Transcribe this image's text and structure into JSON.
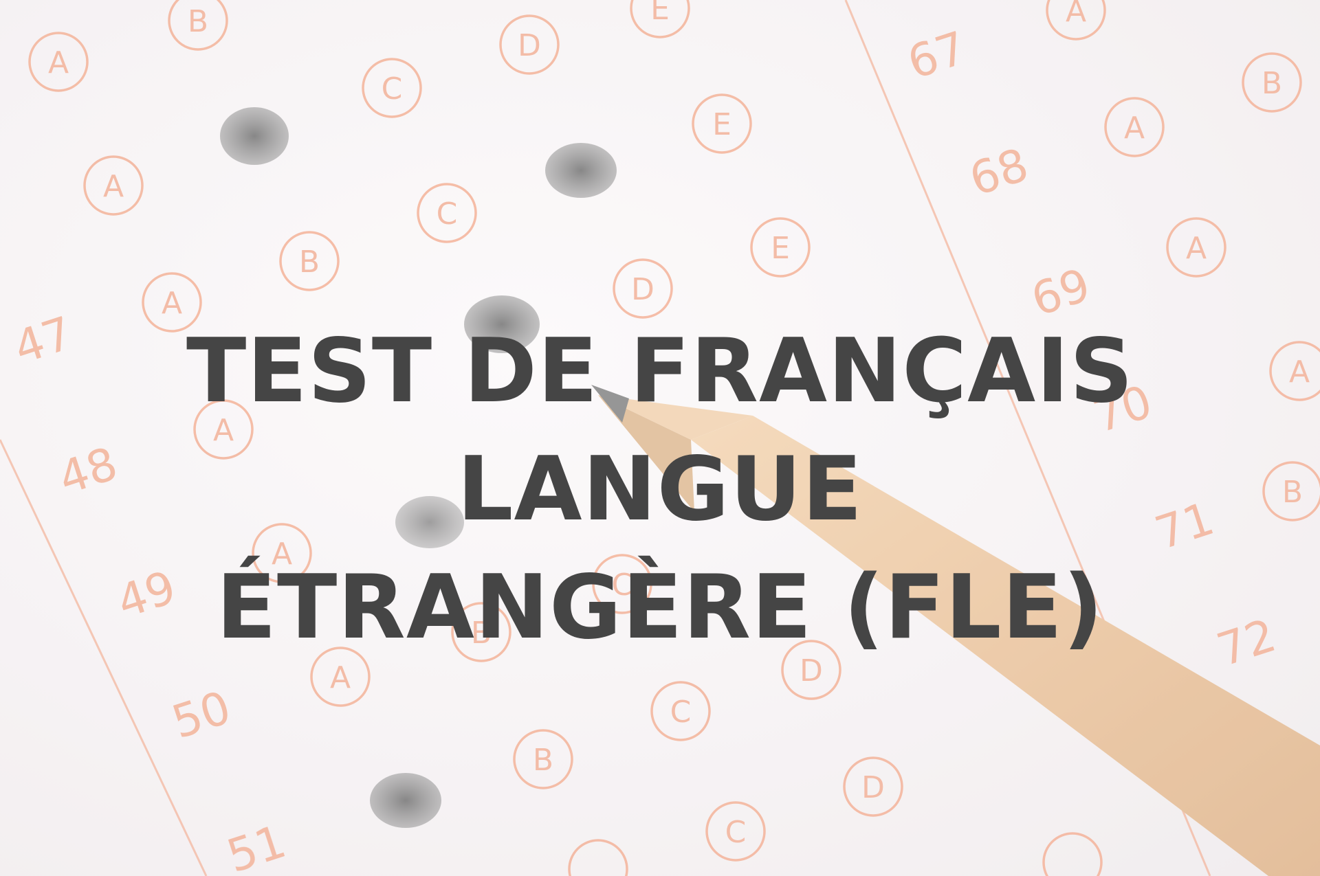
{
  "title": {
    "line1": "TEST DE FRANÇAIS LANGUE",
    "line2": "ÉTRANGÈRE (FLE)"
  },
  "answer_sheet": {
    "question_numbers": [
      "47",
      "48",
      "49",
      "50",
      "51",
      "67",
      "68",
      "69",
      "70",
      "71",
      "72"
    ],
    "options": [
      "A",
      "B",
      "C",
      "D",
      "E"
    ],
    "mark_color": "#e88a6a",
    "pencil_fill_color": "#5a5a5a"
  },
  "colors": {
    "title": "#454545",
    "paper": "#f5f1f2",
    "pencil_wood": "#e9bf92",
    "pencil_lead": "#6e6e6e"
  }
}
